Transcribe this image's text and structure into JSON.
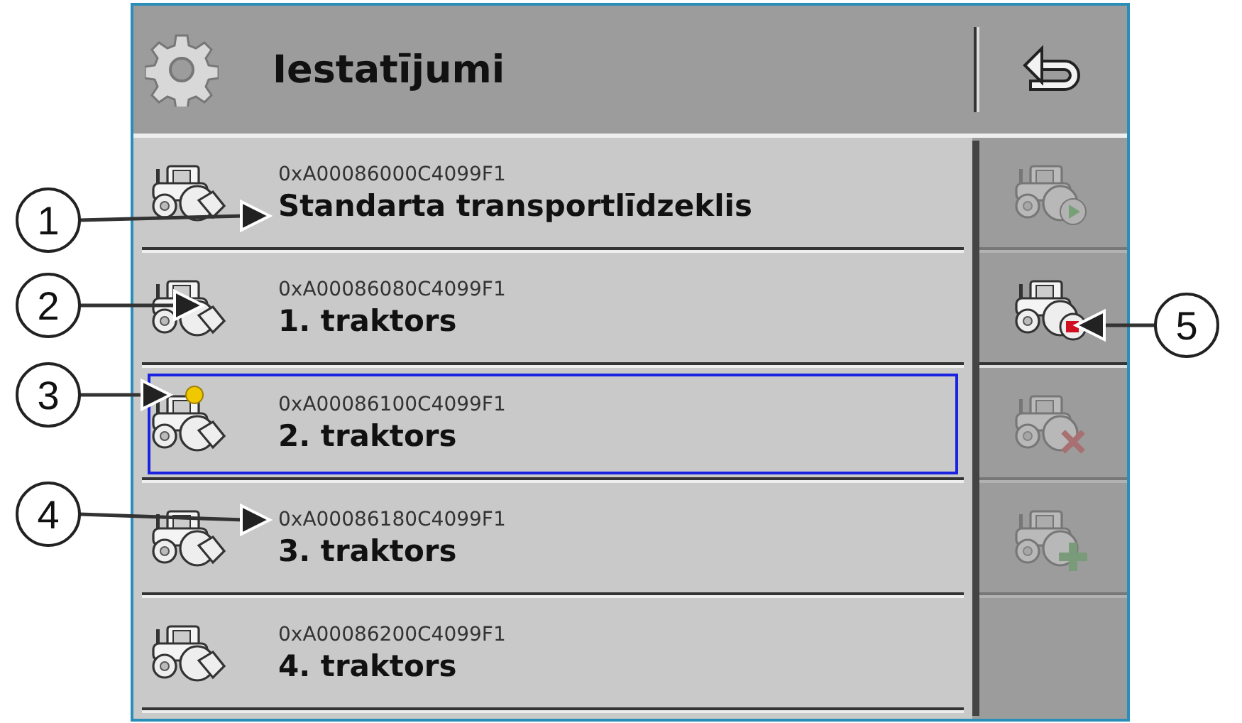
{
  "header": {
    "title": "Iestatījumi"
  },
  "vehicles": [
    {
      "id": "0xA00086000C4099F1",
      "name": "Standarta transportlīdzeklis",
      "active": false,
      "selected": false
    },
    {
      "id": "0xA00086080C4099F1",
      "name": "1. traktors",
      "active": false,
      "selected": false
    },
    {
      "id": "0xA00086100C4099F1",
      "name": "2. traktors",
      "active": true,
      "selected": true
    },
    {
      "id": "0xA00086180C4099F1",
      "name": "3. traktors",
      "active": false,
      "selected": false
    },
    {
      "id": "0xA00086200C4099F1",
      "name": "4. traktors",
      "active": false,
      "selected": false
    }
  ],
  "side_buttons": [
    {
      "kind": "activate",
      "disabled": true
    },
    {
      "kind": "deactivate",
      "disabled": false
    },
    {
      "kind": "delete",
      "disabled": true
    },
    {
      "kind": "add",
      "disabled": true
    }
  ],
  "left_callouts": [
    {
      "number": "1"
    },
    {
      "number": "2"
    },
    {
      "number": "3"
    },
    {
      "number": "4"
    }
  ],
  "right_callouts": [
    {
      "number": "5"
    }
  ]
}
